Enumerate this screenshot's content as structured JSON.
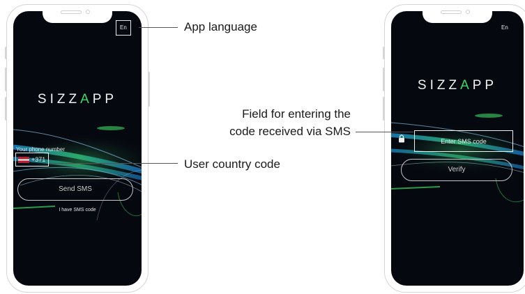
{
  "left_screen": {
    "lang_label": "En",
    "logo_prefix": "SIZZ",
    "logo_accent": "A",
    "logo_suffix": "PP",
    "phone_label": "Your phone number",
    "country_code": "+371",
    "send_sms_label": "Send SMS",
    "have_code_label": "I have SMS code"
  },
  "right_screen": {
    "lang_label": "En",
    "logo_prefix": "SIZZ",
    "logo_accent": "A",
    "logo_suffix": "PP",
    "sms_placeholder": "Enter SMS code",
    "verify_label": "Verify"
  },
  "callouts": {
    "app_language": "App language",
    "user_country_code": "User country code",
    "sms_field_line1": "Field for entering the",
    "sms_field_line2": "code received via SMS"
  },
  "colors": {
    "screen_bg": "#05080f",
    "accent_green": "#3cd866",
    "wave_blue": "#2f7fd6"
  }
}
